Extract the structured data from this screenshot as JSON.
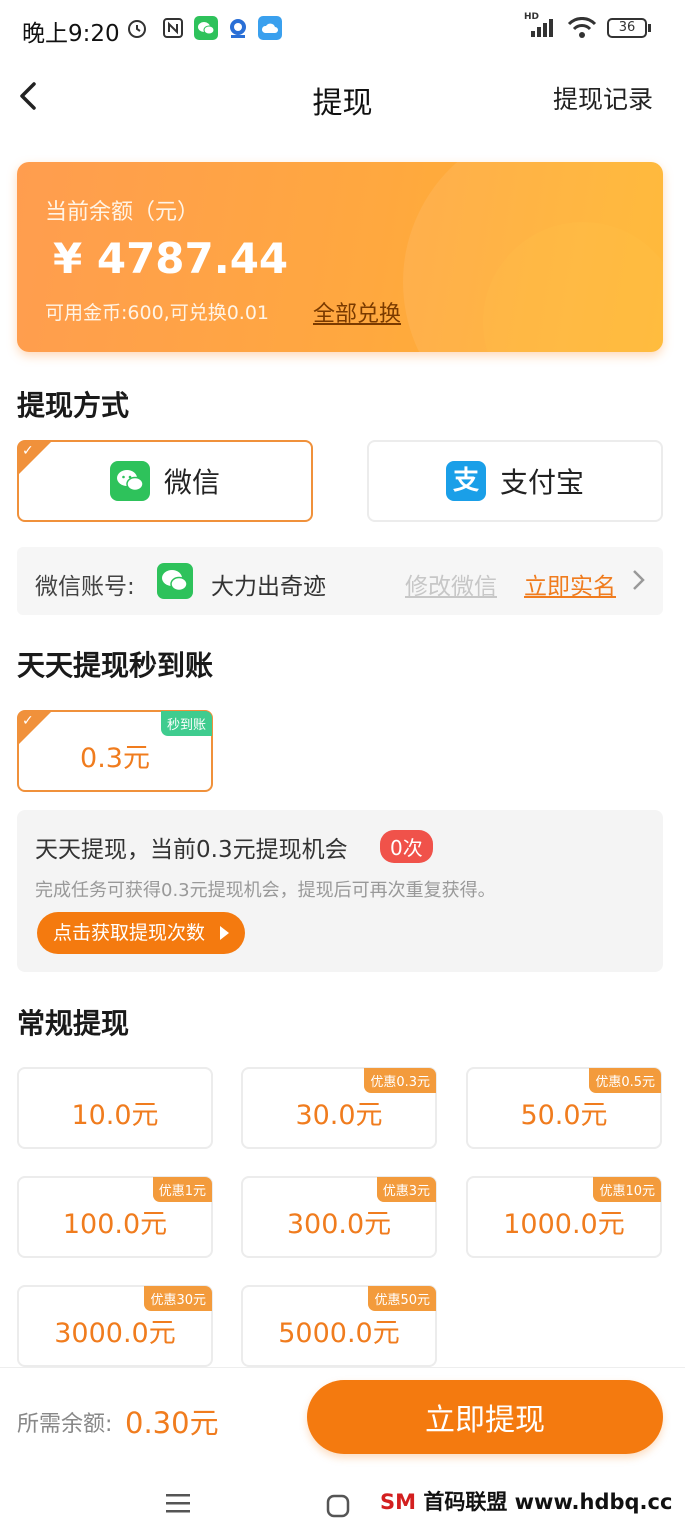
{
  "status_bar": {
    "time": "晚上9:20",
    "battery": "36",
    "network": "HD"
  },
  "nav": {
    "title": "提现",
    "record": "提现记录"
  },
  "balance": {
    "label": "当前余额（元）",
    "amount": "¥ 4787.44",
    "coins_text": "可用金币:600,可兑换0.01",
    "exchange_all": "全部兑换"
  },
  "method": {
    "title": "提现方式",
    "options": [
      {
        "label": "微信",
        "selected": true,
        "icon": "wechat-icon"
      },
      {
        "label": "支付宝",
        "selected": false,
        "icon": "alipay-icon"
      }
    ],
    "account_label": "微信账号:",
    "account_name": "大力出奇迹",
    "modify": "修改微信",
    "realname": "立即实名"
  },
  "daily": {
    "title": "天天提现秒到账",
    "option_value": "0.3元",
    "option_badge": "秒到账",
    "info_title": "天天提现，当前0.3元提现机会",
    "info_count": "0次",
    "info_desc": "完成任务可获得0.3元提现机会，提现后可再次重复获得。",
    "info_button": "点击获取提现次数"
  },
  "regular": {
    "title": "常规提现",
    "amounts": [
      {
        "value": "10.0元",
        "badge": ""
      },
      {
        "value": "30.0元",
        "badge": "优惠0.3元"
      },
      {
        "value": "50.0元",
        "badge": "优惠0.5元"
      },
      {
        "value": "100.0元",
        "badge": "优惠1元"
      },
      {
        "value": "300.0元",
        "badge": "优惠3元"
      },
      {
        "value": "1000.0元",
        "badge": "优惠10元"
      },
      {
        "value": "3000.0元",
        "badge": "优惠30元"
      },
      {
        "value": "5000.0元",
        "badge": "优惠50元"
      }
    ]
  },
  "bottom": {
    "need_label": "所需余额:",
    "need_value": "0.30元",
    "submit": "立即提现"
  },
  "watermark": {
    "brand": "SM",
    "text": "首码联盟 www.hdbq.cc"
  },
  "colors": {
    "accent": "#f47a0f",
    "wechat": "#2ec25b",
    "alipay": "#1a9fe8",
    "badge_green": "#3fcc8f"
  }
}
